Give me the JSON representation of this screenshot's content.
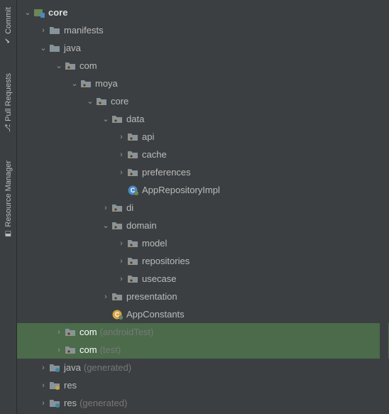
{
  "side_tabs": [
    {
      "id": "commit",
      "label": "Commit"
    },
    {
      "id": "pull-requests",
      "label": "Pull Requests"
    },
    {
      "id": "resource-manager",
      "label": "Resource Manager"
    }
  ],
  "icons": {
    "chevron_right": "›",
    "chevron_down": "⌄"
  },
  "tree": [
    {
      "depth": 0,
      "expand": "down",
      "icon": "module",
      "label": "core",
      "bold": true,
      "name": "module-core"
    },
    {
      "depth": 1,
      "expand": "right",
      "icon": "folder",
      "label": "manifests",
      "name": "folder-manifests"
    },
    {
      "depth": 1,
      "expand": "down",
      "icon": "folder",
      "label": "java",
      "name": "folder-java"
    },
    {
      "depth": 2,
      "expand": "down",
      "icon": "package",
      "label": "com",
      "name": "package-com"
    },
    {
      "depth": 3,
      "expand": "down",
      "icon": "package",
      "label": "moya",
      "name": "package-moya"
    },
    {
      "depth": 4,
      "expand": "down",
      "icon": "package",
      "label": "core",
      "name": "package-core"
    },
    {
      "depth": 5,
      "expand": "down",
      "icon": "package",
      "label": "data",
      "name": "package-data"
    },
    {
      "depth": 6,
      "expand": "right",
      "icon": "package",
      "label": "api",
      "name": "package-api"
    },
    {
      "depth": 6,
      "expand": "right",
      "icon": "package",
      "label": "cache",
      "name": "package-cache"
    },
    {
      "depth": 6,
      "expand": "right",
      "icon": "package",
      "label": "preferences",
      "name": "package-preferences"
    },
    {
      "depth": 6,
      "expand": "none",
      "icon": "kclass",
      "label": "AppRepositoryImpl",
      "name": "file-apprepositoryimpl"
    },
    {
      "depth": 5,
      "expand": "right",
      "icon": "package",
      "label": "di",
      "name": "package-di"
    },
    {
      "depth": 5,
      "expand": "down",
      "icon": "package",
      "label": "domain",
      "name": "package-domain"
    },
    {
      "depth": 6,
      "expand": "right",
      "icon": "package",
      "label": "model",
      "name": "package-model"
    },
    {
      "depth": 6,
      "expand": "right",
      "icon": "package",
      "label": "repositories",
      "name": "package-repositories"
    },
    {
      "depth": 6,
      "expand": "right",
      "icon": "package",
      "label": "usecase",
      "name": "package-usecase"
    },
    {
      "depth": 5,
      "expand": "right",
      "icon": "package",
      "label": "presentation",
      "name": "package-presentation"
    },
    {
      "depth": 5,
      "expand": "none",
      "icon": "kobject",
      "label": "AppConstants",
      "name": "file-appconstants"
    },
    {
      "depth": 2,
      "expand": "right",
      "icon": "package",
      "label": "com",
      "hint": "(androidTest)",
      "name": "package-com-androidtest",
      "selected": true
    },
    {
      "depth": 2,
      "expand": "right",
      "icon": "package",
      "label": "com",
      "hint": "(test)",
      "name": "package-com-test",
      "selected": true
    },
    {
      "depth": 1,
      "expand": "right",
      "icon": "genfolder",
      "label": "java",
      "hint": "(generated)",
      "name": "folder-java-generated"
    },
    {
      "depth": 1,
      "expand": "right",
      "icon": "resfolder",
      "label": "res",
      "name": "folder-res"
    },
    {
      "depth": 1,
      "expand": "right",
      "icon": "genfolder",
      "label": "res",
      "hint": "(generated)",
      "name": "folder-res-generated"
    }
  ]
}
